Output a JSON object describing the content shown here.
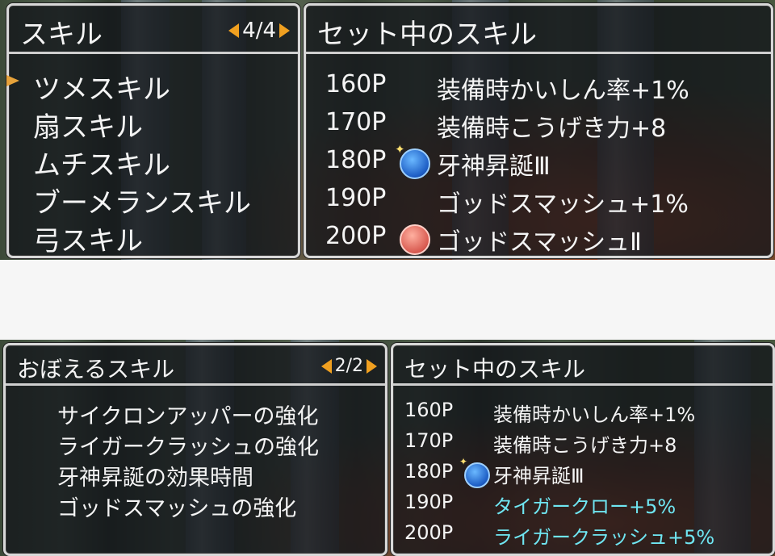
{
  "top": {
    "left_panel": {
      "title": "スキル",
      "page": "4/4",
      "items": [
        {
          "label": "ツメスキル",
          "selected": true
        },
        {
          "label": "扇スキル",
          "selected": false
        },
        {
          "label": "ムチスキル",
          "selected": false
        },
        {
          "label": "ブーメランスキル",
          "selected": false
        },
        {
          "label": "弓スキル",
          "selected": false
        }
      ]
    },
    "right_panel": {
      "title": "セット中のスキル",
      "rows": [
        {
          "points": "160P",
          "name": "装備時かいしん率+1%",
          "icon": "",
          "color": "#f4f4f4"
        },
        {
          "points": "170P",
          "name": "装備時こうげき力+8",
          "icon": "",
          "color": "#f4f4f4"
        },
        {
          "points": "180P",
          "name": "牙神昇誕Ⅲ",
          "icon": "blue-skill-icon",
          "color": "#f4f4f4"
        },
        {
          "points": "190P",
          "name": "ゴッドスマッシュ+1%",
          "icon": "",
          "color": "#f4f4f4"
        },
        {
          "points": "200P",
          "name": "ゴッドスマッシュⅡ",
          "icon": "red-skill-icon",
          "color": "#f4f4f4"
        }
      ]
    }
  },
  "bottom": {
    "left_panel": {
      "title": "おぼえるスキル",
      "page": "2/2",
      "items": [
        {
          "label": "サイクロンアッパーの強化"
        },
        {
          "label": "ライガークラッシュの強化"
        },
        {
          "label": "牙神昇誕の効果時間"
        },
        {
          "label": "ゴッドスマッシュの強化"
        }
      ]
    },
    "right_panel": {
      "title": "セット中のスキル",
      "rows": [
        {
          "points": "160P",
          "name": "装備時かいしん率+1%",
          "icon": "",
          "color": "#f4f4f4"
        },
        {
          "points": "170P",
          "name": "装備時こうげき力+8",
          "icon": "",
          "color": "#f4f4f4"
        },
        {
          "points": "180P",
          "name": "牙神昇誕Ⅲ",
          "icon": "blue-skill-icon",
          "color": "#f4f4f4"
        },
        {
          "points": "190P",
          "name": "タイガークロー+5%",
          "icon": "",
          "color": "#6fe6f2"
        },
        {
          "points": "200P",
          "name": "ライガークラッシュ+5%",
          "icon": "",
          "color": "#6fe6f2"
        }
      ]
    }
  },
  "colors": {
    "accent_arrow": "#f0a020",
    "cursor": "#e6a23a",
    "highlight_text": "#6fe6f2"
  }
}
